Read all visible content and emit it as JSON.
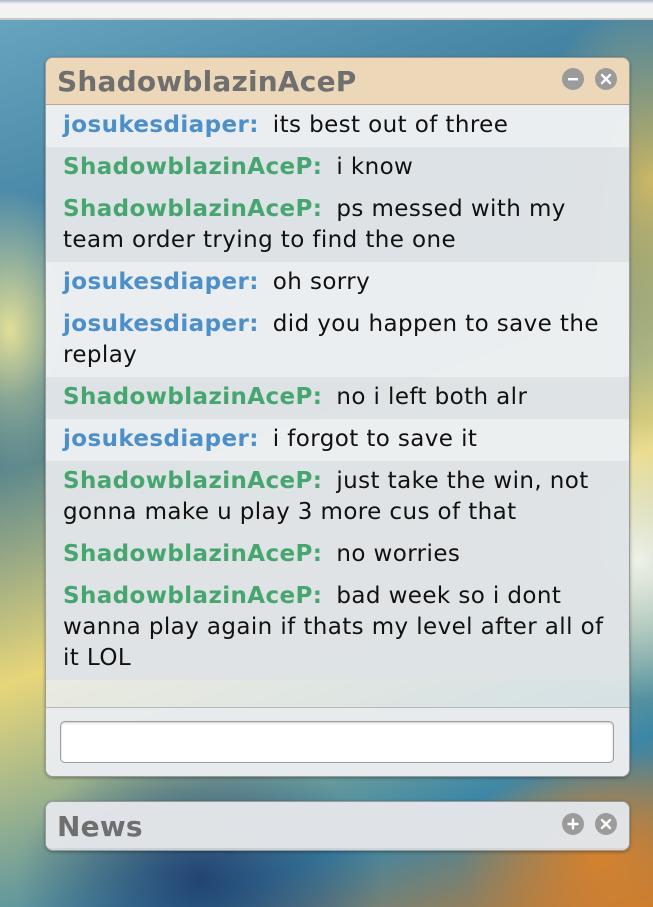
{
  "chat_window": {
    "title": "ShadowblazinAceP",
    "messages": [
      {
        "sender": "josukesdiaper:",
        "text": "its best out of three",
        "color": "#4d8fc9"
      },
      {
        "sender": "ShadowblazinAceP:",
        "text": "i know",
        "color": "#47a66f"
      },
      {
        "sender": "ShadowblazinAceP:",
        "text": "ps messed with my team order trying to find the one",
        "color": "#47a66f"
      },
      {
        "sender": "josukesdiaper:",
        "text": "oh sorry",
        "color": "#4d8fc9"
      },
      {
        "sender": "josukesdiaper:",
        "text": "did you happen to save the replay",
        "color": "#4d8fc9"
      },
      {
        "sender": "ShadowblazinAceP:",
        "text": "no i left both alr",
        "color": "#47a66f"
      },
      {
        "sender": "josukesdiaper:",
        "text": "i forgot to save it",
        "color": "#4d8fc9"
      },
      {
        "sender": "ShadowblazinAceP:",
        "text": "just take the win, not gonna make u play 3 more cus of that",
        "color": "#47a66f"
      },
      {
        "sender": "ShadowblazinAceP:",
        "text": "no worries",
        "color": "#47a66f"
      },
      {
        "sender": "ShadowblazinAceP:",
        "text": "bad week so i dont wanna play again if thats my level after all of it LOL",
        "color": "#47a66f"
      }
    ],
    "input_value": "",
    "buttons": {
      "minimize_icon": "minus-circle-icon",
      "close_icon": "close-circle-icon"
    }
  },
  "news_window": {
    "title": "News",
    "buttons": {
      "expand_icon": "plus-circle-icon",
      "close_icon": "close-circle-icon"
    }
  }
}
